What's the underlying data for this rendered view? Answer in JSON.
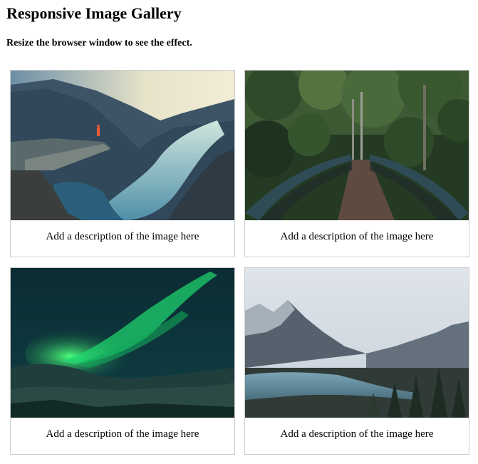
{
  "header": {
    "title": "Responsive Image Gallery",
    "subtitle": "Resize the browser window to see the effect."
  },
  "gallery": [
    {
      "description": "Add a description of the image here"
    },
    {
      "description": "Add a description of the image here"
    },
    {
      "description": "Add a description of the image here"
    },
    {
      "description": "Add a description of the image here"
    }
  ]
}
